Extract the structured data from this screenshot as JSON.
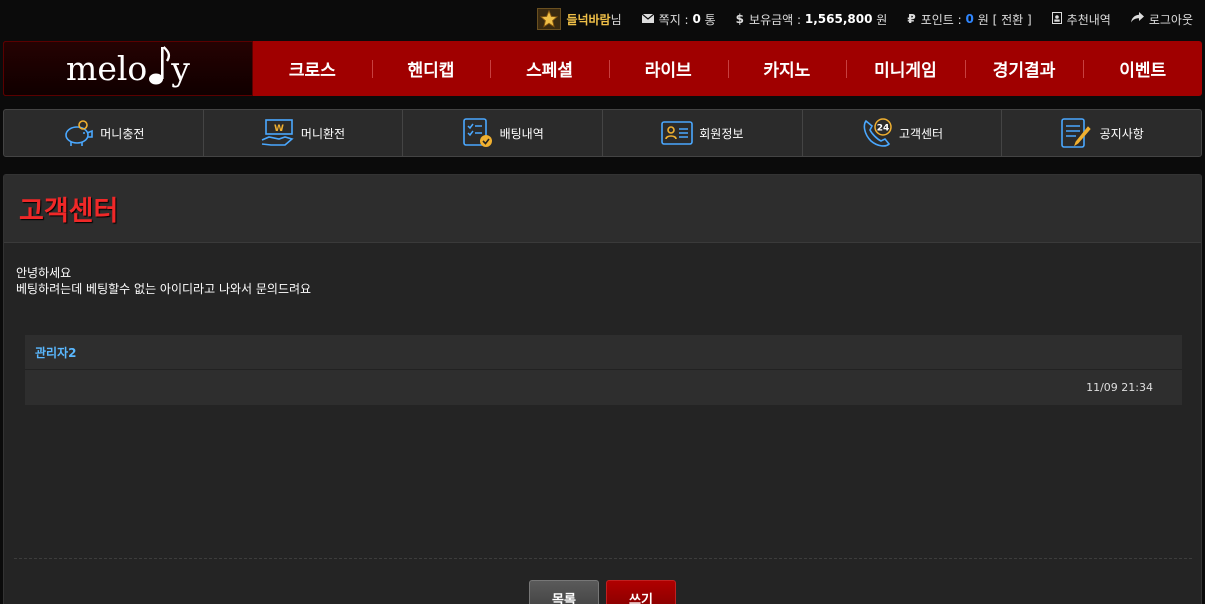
{
  "topbar": {
    "username": "들넉바람",
    "username_suffix": "님",
    "messages_label": "쪽지 :",
    "messages_count": "0",
    "messages_unit": "통",
    "balance_label": "보유금액 :",
    "balance_value": "1,565,800",
    "balance_unit": "원",
    "points_label": "포인트 :",
    "points_value": "0",
    "points_unit": "원",
    "convert_label": "[ 전환 ]",
    "referral_label": "추천내역",
    "logout_label": "로그아웃"
  },
  "logo": {
    "text": "melo",
    "text_end": "y"
  },
  "main_nav": [
    {
      "label": "크로스"
    },
    {
      "label": "핸디캡"
    },
    {
      "label": "스페셜"
    },
    {
      "label": "라이브"
    },
    {
      "label": "카지노"
    },
    {
      "label": "미니게임"
    },
    {
      "label": "경기결과"
    },
    {
      "label": "이벤트"
    }
  ],
  "sub_nav": [
    {
      "label": "머니충전",
      "icon": "piggy-bank-icon"
    },
    {
      "label": "머니환전",
      "icon": "money-hand-icon"
    },
    {
      "label": "배팅내역",
      "icon": "checklist-icon"
    },
    {
      "label": "회원정보",
      "icon": "id-card-icon"
    },
    {
      "label": "고객센터",
      "icon": "support-24-icon"
    },
    {
      "label": "공지사항",
      "icon": "notice-pen-icon"
    }
  ],
  "page": {
    "title": "고객센터",
    "body_line1": "안녕하세요",
    "body_line2": "베팅하려는데 베팅할수 없는 아이디라고 나와서 문의드려요"
  },
  "reply": {
    "author": "관리자2",
    "timestamp": "11/09 21:34"
  },
  "buttons": {
    "list_label": "목록",
    "write_label": "쓰기"
  },
  "colors": {
    "accent_red": "#a00000",
    "title_red": "#f02828",
    "reply_author": "#5ab8ff",
    "icon_blue": "#4aa8ff",
    "icon_gold": "#f0b030"
  }
}
